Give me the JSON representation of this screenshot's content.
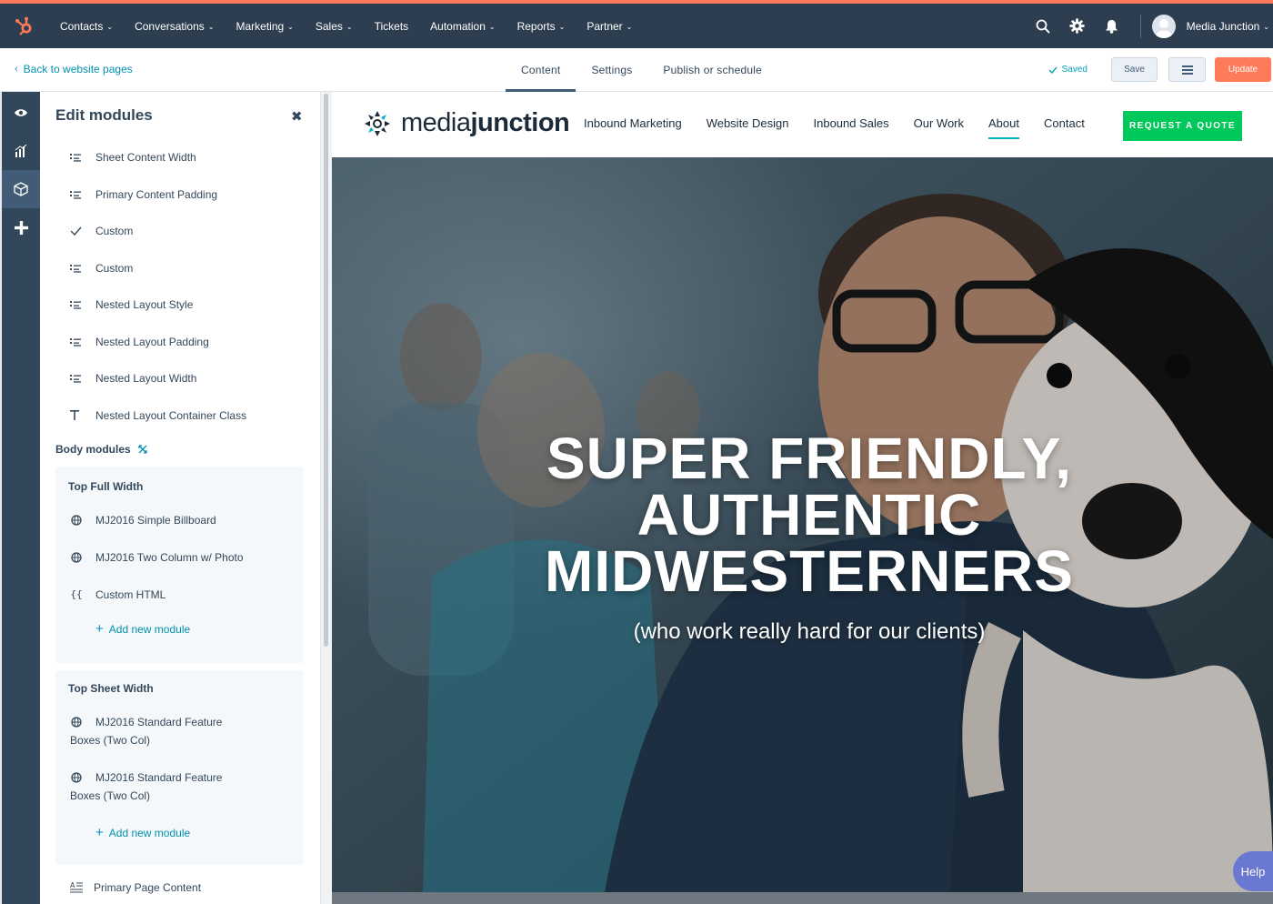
{
  "topnav": {
    "items": [
      "Contacts",
      "Conversations",
      "Marketing",
      "Sales",
      "Tickets",
      "Automation",
      "Reports",
      "Partner"
    ],
    "account_name": "Media Junction"
  },
  "subbar": {
    "back_label": "Back to website pages",
    "tabs": [
      "Content",
      "Settings",
      "Publish or schedule"
    ],
    "active_tab": "Content",
    "saved_label": "Saved",
    "save_label": "Save",
    "update_label": "Update"
  },
  "panel": {
    "title": "Edit modules",
    "modules": [
      {
        "label": "Sheet Content Width",
        "icon": "list-icon"
      },
      {
        "label": "Primary Content Padding",
        "icon": "list-icon"
      },
      {
        "label": "Custom",
        "icon": "checkmark-icon"
      },
      {
        "label": "Custom",
        "icon": "list-icon"
      },
      {
        "label": "Nested Layout Style",
        "icon": "list-icon"
      },
      {
        "label": "Nested Layout Padding",
        "icon": "list-icon"
      },
      {
        "label": "Nested Layout Width",
        "icon": "list-icon"
      },
      {
        "label": "Nested Layout Container Class",
        "icon": "text-icon"
      }
    ],
    "body_modules_label": "Body modules",
    "groups": [
      {
        "title": "Top Full Width",
        "items": [
          "MJ2016 Simple Billboard",
          "MJ2016 Two Column w/ Photo",
          "Custom HTML"
        ],
        "add_label": "Add new module"
      },
      {
        "title": "Top Sheet Width",
        "items": [
          "MJ2016 Standard Feature Boxes (Two Col)",
          "MJ2016 Standard Feature Boxes (Two Col)"
        ],
        "add_label": "Add new module"
      }
    ],
    "bottom_item": "Primary Page Content"
  },
  "site": {
    "logo_light": "media",
    "logo_bold": "junction",
    "nav": [
      "Inbound Marketing",
      "Website Design",
      "Inbound Sales",
      "Our Work",
      "About",
      "Contact"
    ],
    "active_nav": "About",
    "quote_label": "REQUEST A QUOTE",
    "hero_line1": "SUPER FRIENDLY,",
    "hero_line2": "AUTHENTIC",
    "hero_line3": "MIDWESTERNERS",
    "hero_sub": "(who work really hard for our clients)"
  },
  "help_label": "Help",
  "colors": {
    "nav_bg": "#2d3e50",
    "accent_orange": "#ff7a59",
    "link_teal": "#0091ae",
    "quote_green": "#00c85a"
  }
}
